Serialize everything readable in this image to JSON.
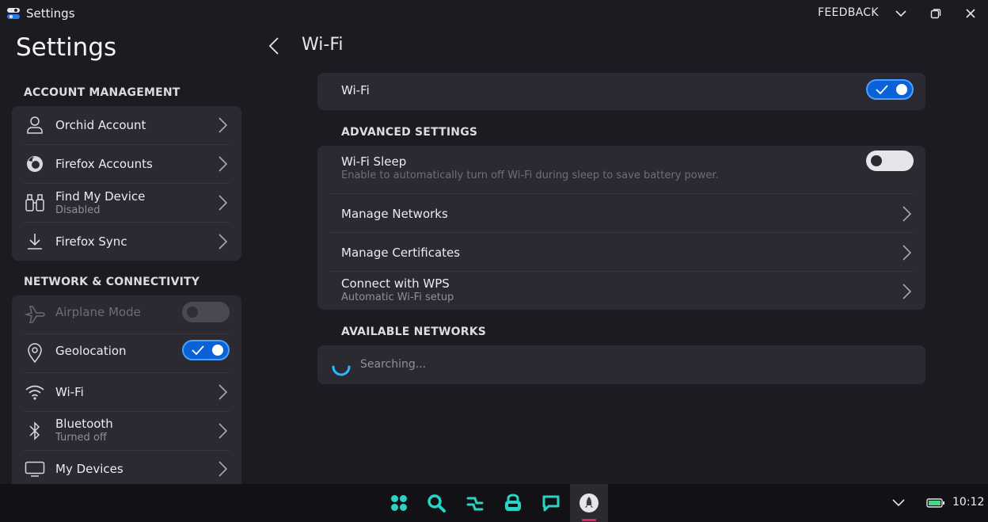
{
  "window": {
    "app_title": "Settings",
    "feedback_label": "FEEDBACK"
  },
  "sidebar": {
    "title": "Settings",
    "sections": [
      {
        "header": "ACCOUNT MANAGEMENT",
        "items": [
          {
            "label": "Orchid Account",
            "icon": "person-icon"
          },
          {
            "label": "Firefox Accounts",
            "icon": "firefox-icon"
          },
          {
            "label": "Find My Device",
            "sublabel": "Disabled",
            "icon": "binoculars-icon"
          },
          {
            "label": "Firefox Sync",
            "icon": "download-icon"
          }
        ]
      },
      {
        "header": "NETWORK & CONNECTIVITY",
        "items": [
          {
            "label": "Airplane Mode",
            "icon": "airplane-icon",
            "toggle": false,
            "disabled": true
          },
          {
            "label": "Geolocation",
            "icon": "location-pin-icon",
            "toggle": true
          },
          {
            "label": "Wi-Fi",
            "icon": "wifi-icon"
          },
          {
            "label": "Bluetooth",
            "sublabel": "Turned off",
            "icon": "bluetooth-icon"
          },
          {
            "label": "My Devices",
            "icon": "monitor-icon"
          }
        ]
      }
    ]
  },
  "main": {
    "back_icon": "chevron-left-icon",
    "title": "Wi-Fi",
    "wifi_toggle": {
      "label": "Wi-Fi",
      "on": true
    },
    "advanced_header": "ADVANCED SETTINGS",
    "advanced_items": [
      {
        "label": "Wi-Fi Sleep",
        "sublabel": "Enable to automatically turn off Wi-Fi during sleep to save battery power.",
        "toggle": false
      },
      {
        "label": "Manage Networks"
      },
      {
        "label": "Manage Certificates"
      },
      {
        "label": "Connect with WPS",
        "sublabel": "Automatic Wi-Fi setup"
      }
    ],
    "available_header": "AVAILABLE NETWORKS",
    "searching_text": "Searching..."
  },
  "taskbar": {
    "apps": [
      "apps-grid-icon",
      "search-icon",
      "switch-icon",
      "store-icon",
      "chat-icon",
      "rocket-icon"
    ],
    "time": "10:12",
    "colors": {
      "accent": "#0a62d6",
      "teal": "#2ad3c5",
      "active_marker": "#e0245e"
    }
  }
}
